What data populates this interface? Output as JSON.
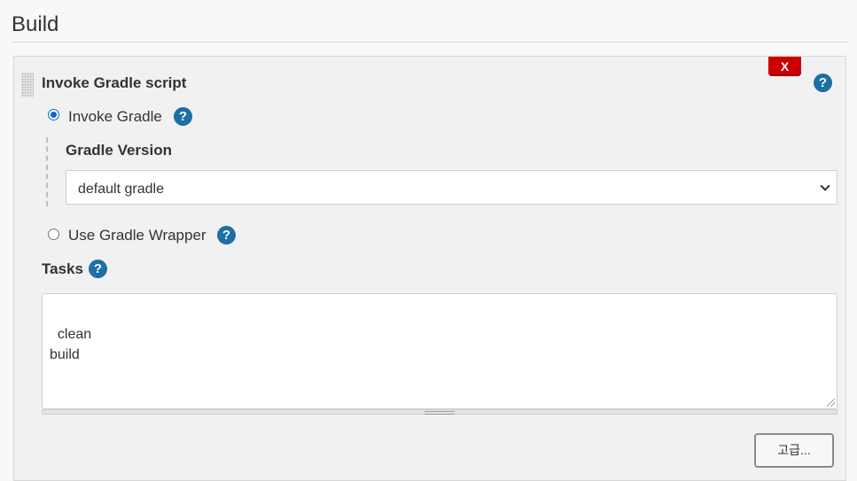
{
  "section": {
    "title": "Build"
  },
  "step": {
    "title": "Invoke Gradle script",
    "delete_label": "X",
    "help": "?",
    "options": {
      "invoke_gradle": {
        "label": "Invoke Gradle",
        "selected": true,
        "help": "?"
      },
      "gradle_version": {
        "label": "Gradle Version",
        "value": "default gradle"
      },
      "use_wrapper": {
        "label": "Use Gradle Wrapper",
        "selected": false,
        "help": "?"
      }
    },
    "tasks": {
      "label": "Tasks",
      "help": "?",
      "value": "clean\nbuild"
    },
    "advanced_label": "고급..."
  },
  "colors": {
    "delete": "#cc0000",
    "help": "#1d6fa5",
    "radio": "#0a69d4"
  }
}
